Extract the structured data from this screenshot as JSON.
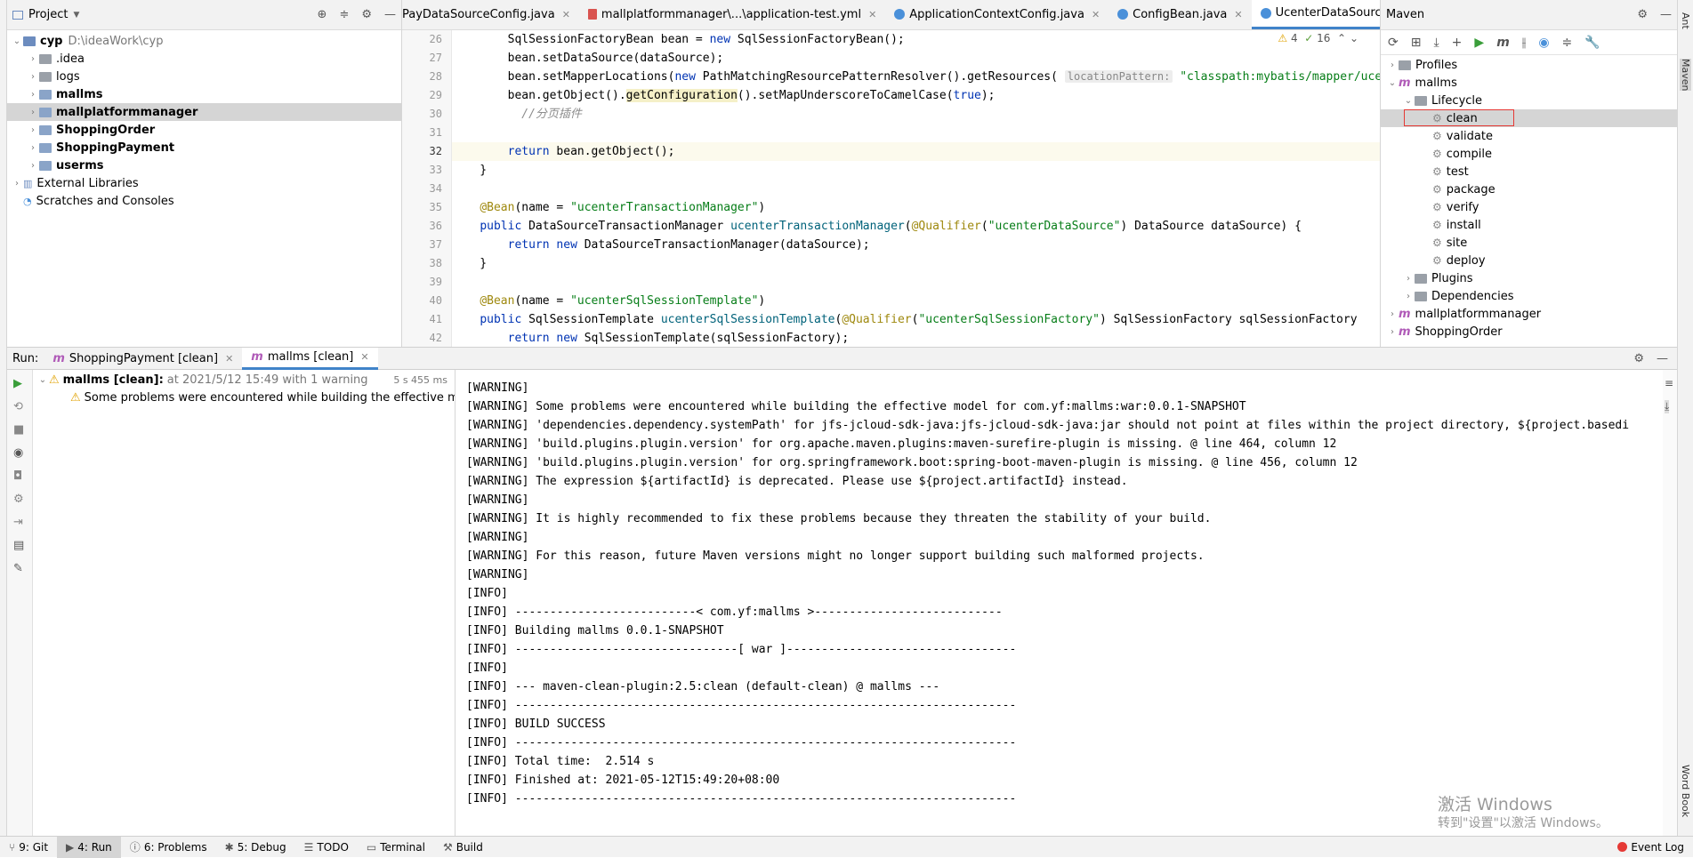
{
  "project": {
    "title": "Project",
    "items": [
      {
        "label": "cyp",
        "path": "D:\\ideaWork\\cyp"
      },
      {
        "label": ".idea"
      },
      {
        "label": "logs"
      },
      {
        "label": "mallms"
      },
      {
        "label": "mallplatformmanager"
      },
      {
        "label": "ShoppingOrder"
      },
      {
        "label": "ShoppingPayment"
      },
      {
        "label": "userms"
      },
      {
        "label": "External Libraries"
      },
      {
        "label": "Scratches and Consoles"
      }
    ]
  },
  "editor": {
    "tabs": [
      "PayDataSourceConfig.java",
      "mallplatformmanager\\...\\application-test.yml",
      "ApplicationContextConfig.java",
      "ConfigBean.java",
      "UcenterDataSourceConfig.java"
    ],
    "warnings_count": "4",
    "ok_count": "16",
    "line_numbers": [
      "26",
      "27",
      "28",
      "29",
      "30",
      "31",
      "32",
      "33",
      "34",
      "35",
      "36",
      "37",
      "38",
      "39",
      "40",
      "41",
      "42"
    ],
    "hint_location": "locationPattern:",
    "code": {
      "l26a": "        SqlSessionFactoryBean bean = ",
      "l26b": "new",
      "l26c": " SqlSessionFactoryBean();",
      "l27": "        bean.setDataSource(dataSource);",
      "l28a": "        bean.setMapperLocations(",
      "l28b": "new",
      "l28c": " PathMatchingResourcePatternResolver().getResources(",
      "l28d": "\"classpath:mybatis/mapper/ucenter/*.xml\"",
      "l29a": "        bean.getObject().",
      "l29b": "getConfiguration",
      "l29c": "().setMapUnderscoreToCamelCase(",
      "l29d": "true",
      "l29e": ");",
      "l30": "          //分页插件",
      "l32a": "        ",
      "l32b": "return",
      "l32c": " bean.getObject();",
      "l33": "    }",
      "l35a": "@Bean",
      "l35b": "(name = ",
      "l35c": "\"ucenterTransactionManager\"",
      "l35d": ")",
      "l36a": "public",
      "l36b": " DataSourceTransactionManager ",
      "l36c": "ucenterTransactionManager",
      "l36d": "(",
      "l36e": "@Qualifier",
      "l36f": "(",
      "l36g": "\"ucenterDataSource\"",
      "l36h": ") DataSource dataSource) {",
      "l37a": "        ",
      "l37b": "return new",
      "l37c": " DataSourceTransactionManager(dataSource);",
      "l38": "    }",
      "l40a": "@Bean",
      "l40b": "(name = ",
      "l40c": "\"ucenterSqlSessionTemplate\"",
      "l40d": ")",
      "l41a": "public",
      "l41b": " SqlSessionTemplate ",
      "l41c": "ucenterSqlSessionTemplate",
      "l41d": "(",
      "l41e": "@Qualifier",
      "l41f": "(",
      "l41g": "\"ucenterSqlSessionFactory\"",
      "l41h": ") SqlSessionFactory sqlSessionFactory",
      "l42a": "        ",
      "l42b": "return new",
      "l42c": " SqlSessionTemplate(sqlSessionFactory);"
    }
  },
  "maven": {
    "title": "Maven",
    "items": [
      {
        "label": "Profiles"
      },
      {
        "label": "mallms"
      },
      {
        "label": "Lifecycle"
      },
      {
        "label": "clean"
      },
      {
        "label": "validate"
      },
      {
        "label": "compile"
      },
      {
        "label": "test"
      },
      {
        "label": "package"
      },
      {
        "label": "verify"
      },
      {
        "label": "install"
      },
      {
        "label": "site"
      },
      {
        "label": "deploy"
      },
      {
        "label": "Plugins"
      },
      {
        "label": "Dependencies"
      },
      {
        "label": "mallplatformmanager"
      },
      {
        "label": "ShoppingOrder"
      }
    ]
  },
  "run": {
    "label": "Run:",
    "tabs": [
      "ShoppingPayment [clean]",
      "mallms [clean]"
    ],
    "tree_title": "mallms [clean]:",
    "tree_meta": "at 2021/5/12 15:49 with 1 warning",
    "tree_time": "5 s 455 ms",
    "tree_child": "Some problems were encountered while building the effective model fo",
    "console": [
      "[WARNING]",
      "[WARNING] Some problems were encountered while building the effective model for com.yf:mallms:war:0.0.1-SNAPSHOT",
      "[WARNING] 'dependencies.dependency.systemPath' for jfs-jcloud-sdk-java:jfs-jcloud-sdk-java:jar should not point at files within the project directory, ${project.basedi",
      "[WARNING] 'build.plugins.plugin.version' for org.apache.maven.plugins:maven-surefire-plugin is missing. @ line 464, column 12",
      "[WARNING] 'build.plugins.plugin.version' for org.springframework.boot:spring-boot-maven-plugin is missing. @ line 456, column 12",
      "[WARNING] The expression ${artifactId} is deprecated. Please use ${project.artifactId} instead.",
      "[WARNING]",
      "[WARNING] It is highly recommended to fix these problems because they threaten the stability of your build.",
      "[WARNING]",
      "[WARNING] For this reason, future Maven versions might no longer support building such malformed projects.",
      "[WARNING]",
      "[INFO]",
      "[INFO] --------------------------< com.yf:mallms >---------------------------",
      "[INFO] Building mallms 0.0.1-SNAPSHOT",
      "[INFO] --------------------------------[ war ]---------------------------------",
      "[INFO]",
      "[INFO] --- maven-clean-plugin:2.5:clean (default-clean) @ mallms ---",
      "[INFO] ------------------------------------------------------------------------",
      "[INFO] BUILD SUCCESS",
      "[INFO] ------------------------------------------------------------------------",
      "[INFO] Total time:  2.514 s",
      "[INFO] Finished at: 2021-05-12T15:49:20+08:00",
      "[INFO] ------------------------------------------------------------------------"
    ]
  },
  "statusbar": {
    "items": [
      "9: Git",
      "4: Run",
      "6: Problems",
      "5: Debug",
      "TODO",
      "Terminal",
      "Build"
    ],
    "event_log": "Event Log"
  },
  "side": {
    "ant": "Ant",
    "maven": "Maven",
    "wordbook": "Word Book"
  },
  "watermark": {
    "line1": "激活 Windows",
    "line2": "转到\"设置\"以激活 Windows。"
  }
}
